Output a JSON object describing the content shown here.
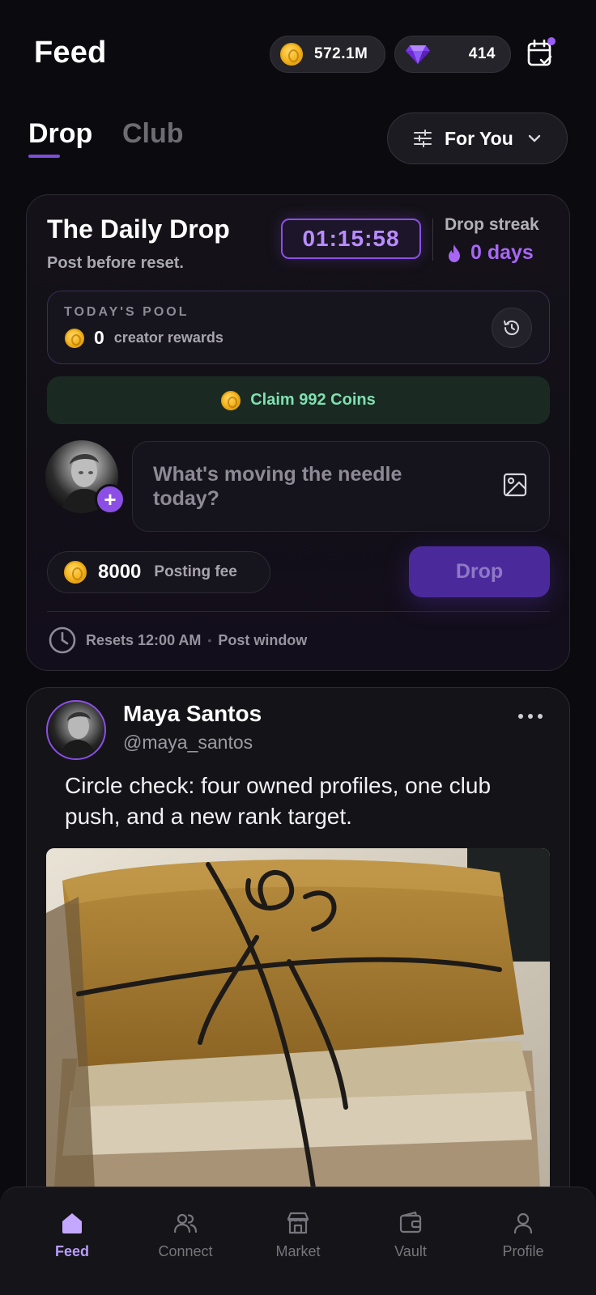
{
  "header": {
    "title": "Feed",
    "coins": "572.1M",
    "gems": "414",
    "calendar_icon": "calendar-check-icon"
  },
  "tabs": [
    {
      "label": "Drop",
      "active": true
    },
    {
      "label": "Club",
      "active": false
    }
  ],
  "filter": {
    "label": "For You"
  },
  "daily_drop": {
    "title": "The Daily Drop",
    "subtitle": "Post before reset.",
    "timer": "01:15:58",
    "streak_label": "Drop streak",
    "streak_value": "0 days",
    "pool_label": "TODAY'S POOL",
    "pool_amount": "0",
    "pool_text": "creator rewards",
    "claim_label": "Claim 992 Coins",
    "compose_placeholder": "What's moving the needle today?",
    "fee_amount": "8000",
    "fee_label": "Posting fee",
    "drop_button": "Drop",
    "reset_text": "Resets 12:00 AM",
    "reset_separator": "•",
    "window_text": "Post window"
  },
  "post": {
    "name": "Maya Santos",
    "handle": "@maya_santos",
    "text": "Circle check: four owned profiles, one club push, and a new rank target."
  },
  "nav": [
    {
      "label": "Feed",
      "icon": "home-icon",
      "active": true
    },
    {
      "label": "Connect",
      "icon": "users-icon",
      "active": false
    },
    {
      "label": "Market",
      "icon": "store-icon",
      "active": false
    },
    {
      "label": "Vault",
      "icon": "wallet-icon",
      "active": false
    },
    {
      "label": "Profile",
      "icon": "user-icon",
      "active": false
    }
  ],
  "colors": {
    "accent": "#8b4fe6",
    "background": "#0b0a0f",
    "claim_text": "#7fe0b0"
  }
}
